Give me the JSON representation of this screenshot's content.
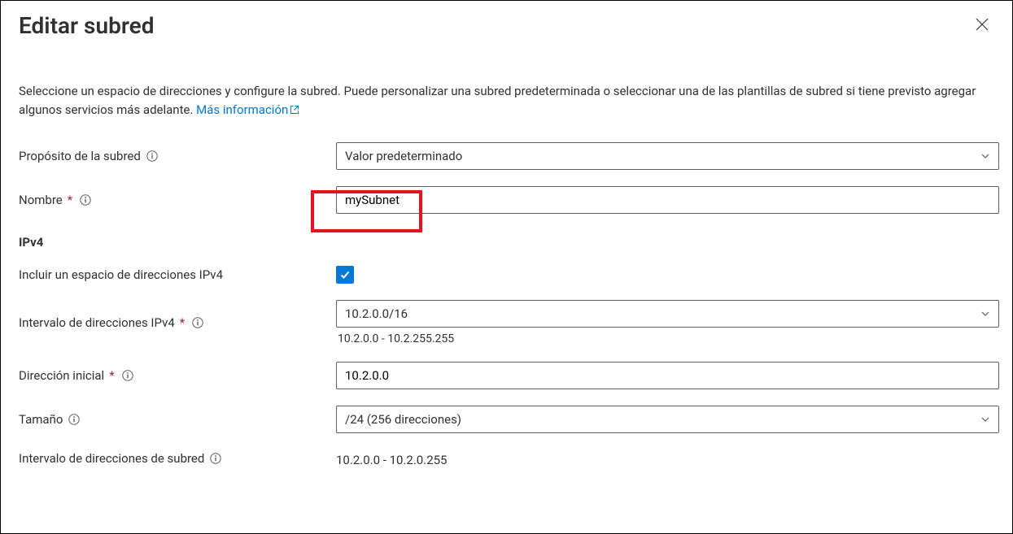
{
  "title": "Editar subred",
  "intro": {
    "text_before": "Seleccione un espacio de direcciones y configure la subred. Puede personalizar una subred predeterminada o seleccionar una de las plantillas de subred si tiene previsto agregar algunos servicios más adelante. ",
    "link_label": "Más información"
  },
  "fields": {
    "purpose": {
      "label": "Propósito de la subred",
      "value": "Valor predeterminado"
    },
    "name": {
      "label": "Nombre",
      "value": "mySubnet"
    },
    "ipv4_heading": "IPv4",
    "include_ipv4": {
      "label": "Incluir un espacio de direcciones IPv4",
      "checked": true
    },
    "ipv4_range": {
      "label": "Intervalo de direcciones IPv4",
      "value": "10.2.0.0/16",
      "hint": "10.2.0.0 - 10.2.255.255"
    },
    "start_addr": {
      "label": "Dirección inicial",
      "value": "10.2.0.0"
    },
    "size": {
      "label": "Tamaño",
      "value": "/24 (256 direcciones)"
    },
    "subnet_range": {
      "label": "Intervalo de direcciones de subred",
      "value": "10.2.0.0 - 10.2.0.255"
    }
  }
}
